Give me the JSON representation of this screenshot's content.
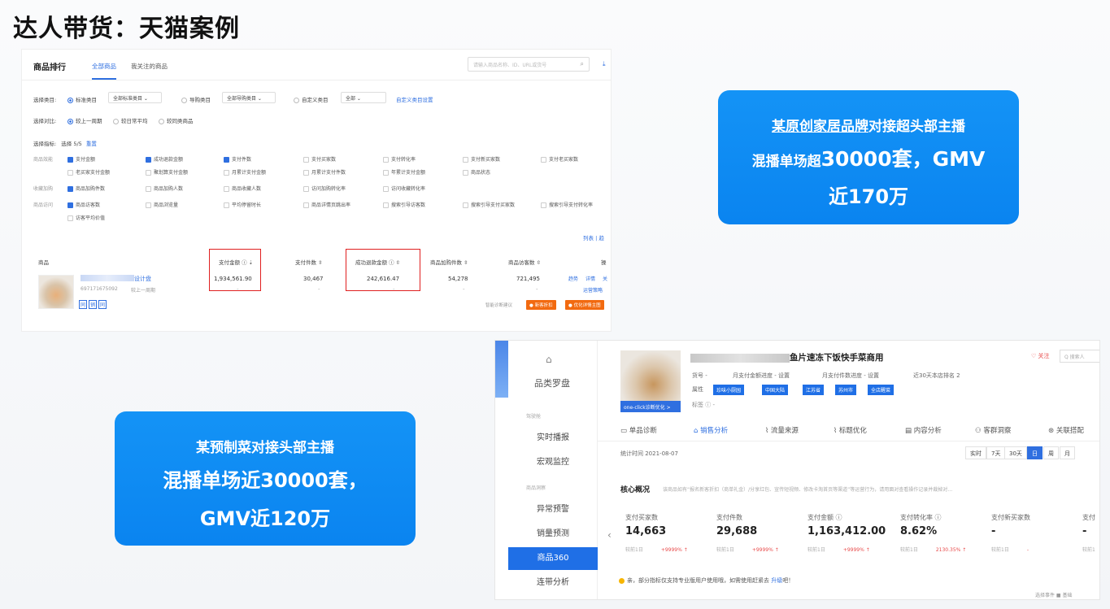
{
  "slide": {
    "title": "达人带货：天猫案例"
  },
  "top_panel": {
    "rank_title": "商品排行",
    "tabs": [
      "全部商品",
      "我关注的商品"
    ],
    "search_placeholder": "请输入商品名称、ID、URL或货号",
    "category_row": {
      "label": "选择类目:",
      "options": [
        "标准类目",
        "导购类目",
        "自定义类目"
      ],
      "select_values": [
        "全部标准类目",
        "全部导购类目",
        "全部"
      ],
      "link": "自定义类目设置"
    },
    "compare_row": {
      "label": "选择对比:",
      "options": [
        "较上一周期",
        "较日常平均",
        "较同类商品"
      ]
    },
    "metric_row": {
      "label": "选择指标:",
      "count": "选择 5/5",
      "reset": "重置"
    },
    "groups": [
      {
        "name": "商品效能",
        "items": [
          "支付金额",
          "成功退款金额",
          "支付件数",
          "支付买家数",
          "支付转化率",
          "支付新买家数",
          "支付老买家数",
          "老买家支付金额",
          "聚划算支付金额",
          "月累计支付金额",
          "月累计支付件数",
          "年累计支付金额",
          "商品状态"
        ],
        "checked": [
          0,
          1,
          2
        ]
      },
      {
        "name": "收藏加购",
        "items": [
          "商品加购件数",
          "商品加购人数",
          "商品收藏人数",
          "访问加购转化率",
          "访问收藏转化率"
        ],
        "checked": [
          0
        ]
      },
      {
        "name": "商品访问",
        "items": [
          "商品访客数",
          "商品浏览量",
          "平均停留时长",
          "商品详情页跳出率",
          "搜索引导访客数",
          "搜索引导支付买家数",
          "搜索引导支付转化率",
          "访客平均价值"
        ],
        "checked": [
          0
        ]
      }
    ],
    "view_links": "列表 | 趋",
    "table": {
      "headers": [
        "商品",
        "支付金额",
        "支付件数",
        "成功退款金额",
        "商品加购件数",
        "商品访客数",
        "操"
      ],
      "product_name_suffix": "设计盘",
      "product_id": "697171675092",
      "compare_label": "较上一周期",
      "tags": [
        "同",
        "销",
        "同"
      ],
      "values": [
        "1,934,561.90",
        "30,467",
        "242,616.47",
        "54,278",
        "721,495"
      ],
      "dashes": [
        "-",
        "-",
        "-",
        "-",
        "-"
      ],
      "actions": [
        "趋势",
        "详情",
        "关",
        "运营策略"
      ],
      "smart_label": "智能诊断建议",
      "btn1": "新客折扣",
      "btn2": "优化详情主图"
    }
  },
  "callout_top": {
    "brand": "某原创家居品牌",
    "line1_rest": "对接超头部主播",
    "line2_prefix": "混播单场超",
    "line2_big": "30000套，GMV",
    "line3": "近170万"
  },
  "callout_bottom": {
    "line1": "某预制菜对接头部主播",
    "line2": "混播单场近30000套，",
    "line3": "GMV近120万"
  },
  "bottom_panel": {
    "sidebar": {
      "category": "品类罗盘",
      "sections": [
        "驾驶舱",
        "商品洞察"
      ],
      "items": [
        "实时播报",
        "宏观监控",
        "异常预警",
        "销量预测",
        "商品360",
        "连带分析"
      ],
      "active_index": 4
    },
    "product": {
      "name": "鱼片速冻下饭快手菜商用",
      "btn": "one-click诊断优化 >",
      "meta": [
        "货号 -",
        "月支付金额进度 - 设置",
        "月支付件数进度 - 设置",
        "近30天本店排名 2"
      ],
      "attr_label": "属性",
      "attr_tags": [
        "珍味小厨园",
        "中国大陆",
        "江苏省",
        "苏州市",
        "全店醒菜"
      ],
      "label_tag": "标签 ⓘ -",
      "follow": "♡ 关注",
      "search_placeholder": "Q 搜索人"
    },
    "tabs": [
      "单品诊断",
      "销售分析",
      "流量来源",
      "标题优化",
      "内容分析",
      "客群洞察",
      "关联搭配"
    ],
    "active_tab": 1,
    "stat_time": "统计时间 2021-08-07",
    "ranges": [
      "实时",
      "7天",
      "30天",
      "日",
      "周",
      "月"
    ],
    "active_range": 3,
    "core_title": "核心概况",
    "core_desc": "该商品如有“报名新客折扣（商单礼金）/分享红包、宣传短视频、修改卡淘首页等渠道”等运营行为，请用面对查看操作记录并裁掉对…",
    "metrics": [
      {
        "label": "支付买家数",
        "value": "14,663",
        "compare": "较前1日",
        "change": "+9999% ↑"
      },
      {
        "label": "支付件数",
        "value": "29,688",
        "compare": "较前1日",
        "change": "+9999% ↑"
      },
      {
        "label": "支付金额 ⓘ",
        "value": "1,163,412.00",
        "compare": "较前1日",
        "change": "+9999% ↑"
      },
      {
        "label": "支付转化率 ⓘ",
        "value": "8.62%",
        "compare": "较前1日",
        "change": "2130.35% ↑"
      },
      {
        "label": "支付新买家数",
        "value": "-",
        "compare": "较前1日",
        "change": "-"
      },
      {
        "label": "支付",
        "value": "-",
        "compare": "较前1",
        "change": ""
      }
    ],
    "note": "亲，部分指标仅支持专业版用户使用哦，如需使用赶紧去",
    "upgrade": "升级",
    "note_end": "吧！",
    "bottom_right": "选择事件  ■ 基础"
  },
  "colors": {
    "accent": "#2f6fe0",
    "callout": "#0a84f0",
    "highlight_box": "#e02020",
    "orange_button": "#f26a10"
  }
}
